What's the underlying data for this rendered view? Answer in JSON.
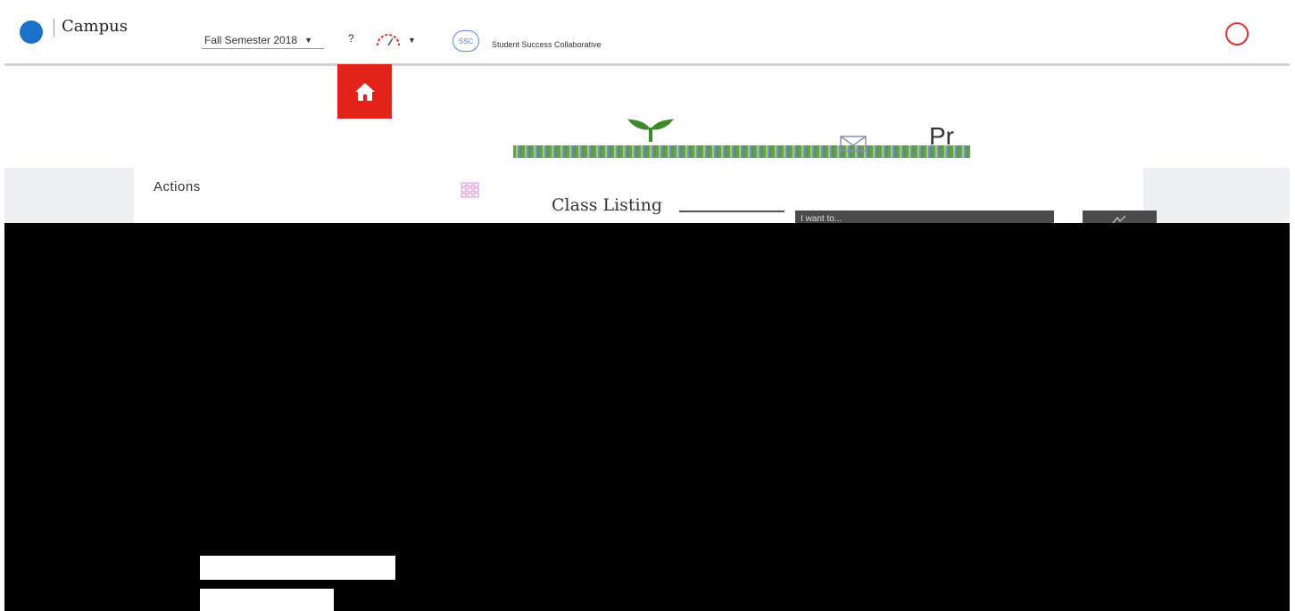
{
  "header": {
    "app_name": "Campus",
    "term": "Fall Semester 2018",
    "help_label": "?",
    "ssc_badge": "SSC",
    "ssc_link": "Student Success Collaborative"
  },
  "brand": {
    "page_heading": "Pr"
  },
  "actions": {
    "label": "Actions"
  },
  "listing": {
    "title": "Class Listing",
    "i_want_to": "I want to..."
  },
  "colors": {
    "home_tile": "#e2231a",
    "brand_green": "#3c8a2a",
    "header_blue": "#1a73c9",
    "content_bg": "#000000"
  },
  "icons": {
    "home": "home-icon",
    "mail": "mail-icon",
    "grid": "grid-icon",
    "edit": "edit-icon"
  }
}
